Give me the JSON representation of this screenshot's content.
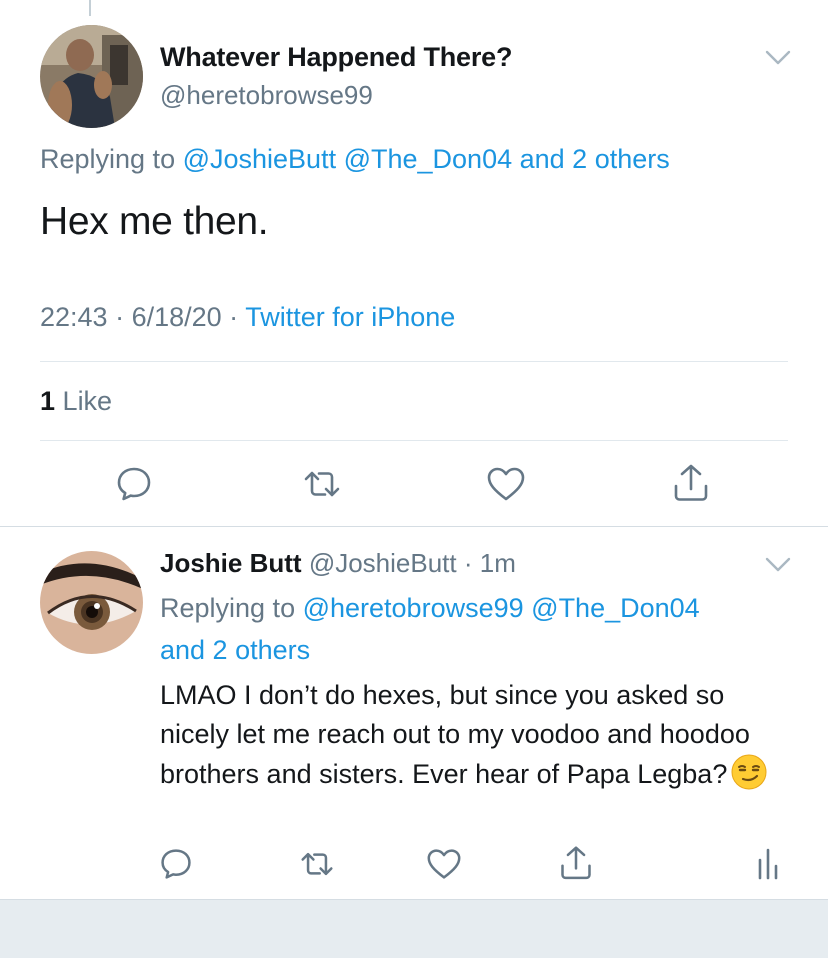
{
  "main_tweet": {
    "display_name": "Whatever Happened There?",
    "handle": "@heretobrowse99",
    "replying_prefix": "Replying to ",
    "replying_mention_1": "@JoshieButt",
    "replying_mention_2": "@The_Don04",
    "replying_others": "and 2 others",
    "body": "Hex me then.",
    "time": "22:43",
    "sep_1": " · ",
    "date": "6/18/20",
    "sep_2": " · ",
    "source": "Twitter for iPhone",
    "like_count": "1",
    "like_label": "Like",
    "actions": [
      "reply-icon",
      "retweet-icon",
      "like-icon",
      "share-icon"
    ]
  },
  "reply_tweet": {
    "display_name": "Joshie Butt",
    "handle": "@JoshieButt",
    "sep": " · ",
    "age": "1m",
    "replying_prefix": "Replying to ",
    "replying_mention_1": "@heretobrowse99",
    "replying_mention_2": "@The_Don04",
    "replying_others": "and 2 others",
    "body": "LMAO I don’t do hexes, but since you asked so nicely let me reach out to my voodoo and hoodoo brothers and sisters. Ever hear of Papa Legba?",
    "emoji": "smirking-face",
    "actions": [
      "reply-icon",
      "retweet-icon",
      "like-icon",
      "share-icon",
      "analytics-icon"
    ]
  },
  "colors": {
    "link": "#1b95e0",
    "secondary_text": "#657786",
    "icon": "#657786",
    "divider": "#e1e8ed",
    "bottom_bar": "#e6ecf0"
  }
}
